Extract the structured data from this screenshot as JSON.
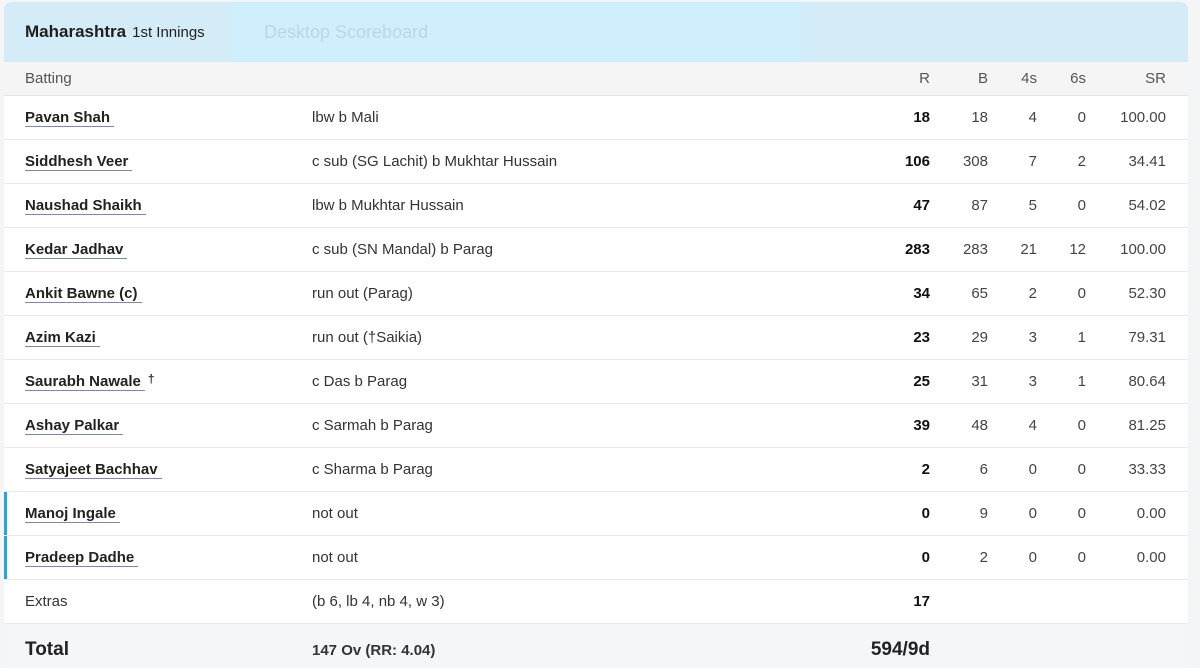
{
  "header": {
    "team": "Maharashtra",
    "innings": "1st Innings",
    "faded_tab": "Desktop Scoreboard"
  },
  "columns": {
    "batting": "Batting",
    "runs": "R",
    "balls": "B",
    "fours": "4s",
    "sixes": "6s",
    "strike_rate": "SR"
  },
  "batters": [
    {
      "name": "Pavan Shah",
      "keeper_mark": "",
      "dismissal": "lbw b Mali",
      "r": "18",
      "b": "18",
      "fours": "4",
      "sixes": "0",
      "sr": "100.00",
      "not_out": false
    },
    {
      "name": "Siddhesh Veer",
      "keeper_mark": "",
      "dismissal": "c sub (SG Lachit) b Mukhtar Hussain",
      "r": "106",
      "b": "308",
      "fours": "7",
      "sixes": "2",
      "sr": "34.41",
      "not_out": false
    },
    {
      "name": "Naushad Shaikh",
      "keeper_mark": "",
      "dismissal": "lbw b Mukhtar Hussain",
      "r": "47",
      "b": "87",
      "fours": "5",
      "sixes": "0",
      "sr": "54.02",
      "not_out": false
    },
    {
      "name": "Kedar Jadhav",
      "keeper_mark": "",
      "dismissal": "c sub (SN Mandal) b Parag",
      "r": "283",
      "b": "283",
      "fours": "21",
      "sixes": "12",
      "sr": "100.00",
      "not_out": false
    },
    {
      "name": "Ankit Bawne (c)",
      "keeper_mark": "",
      "dismissal": "run out (Parag)",
      "r": "34",
      "b": "65",
      "fours": "2",
      "sixes": "0",
      "sr": "52.30",
      "not_out": false
    },
    {
      "name": "Azim Kazi",
      "keeper_mark": "",
      "dismissal": "run out (†Saikia)",
      "r": "23",
      "b": "29",
      "fours": "3",
      "sixes": "1",
      "sr": "79.31",
      "not_out": false
    },
    {
      "name": "Saurabh Nawale",
      "keeper_mark": "†",
      "dismissal": "c Das b Parag",
      "r": "25",
      "b": "31",
      "fours": "3",
      "sixes": "1",
      "sr": "80.64",
      "not_out": false
    },
    {
      "name": "Ashay Palkar",
      "keeper_mark": "",
      "dismissal": "c Sarmah b Parag",
      "r": "39",
      "b": "48",
      "fours": "4",
      "sixes": "0",
      "sr": "81.25",
      "not_out": false
    },
    {
      "name": "Satyajeet Bachhav",
      "keeper_mark": "",
      "dismissal": "c Sharma b Parag",
      "r": "2",
      "b": "6",
      "fours": "0",
      "sixes": "0",
      "sr": "33.33",
      "not_out": false
    },
    {
      "name": "Manoj Ingale",
      "keeper_mark": "",
      "dismissal": "not out",
      "r": "0",
      "b": "9",
      "fours": "0",
      "sixes": "0",
      "sr": "0.00",
      "not_out": true
    },
    {
      "name": "Pradeep Dadhe",
      "keeper_mark": "",
      "dismissal": "not out",
      "r": "0",
      "b": "2",
      "fours": "0",
      "sixes": "0",
      "sr": "0.00",
      "not_out": true
    }
  ],
  "extras": {
    "label": "Extras",
    "detail": "(b 6, lb 4, nb 4, w 3)",
    "runs": "17"
  },
  "total": {
    "label": "Total",
    "overs": "147 Ov (RR: 4.04)",
    "score": "594/9d"
  },
  "colors": {
    "header_bg": "#d4ecf8",
    "not_out_accent": "#2aa4dc"
  }
}
